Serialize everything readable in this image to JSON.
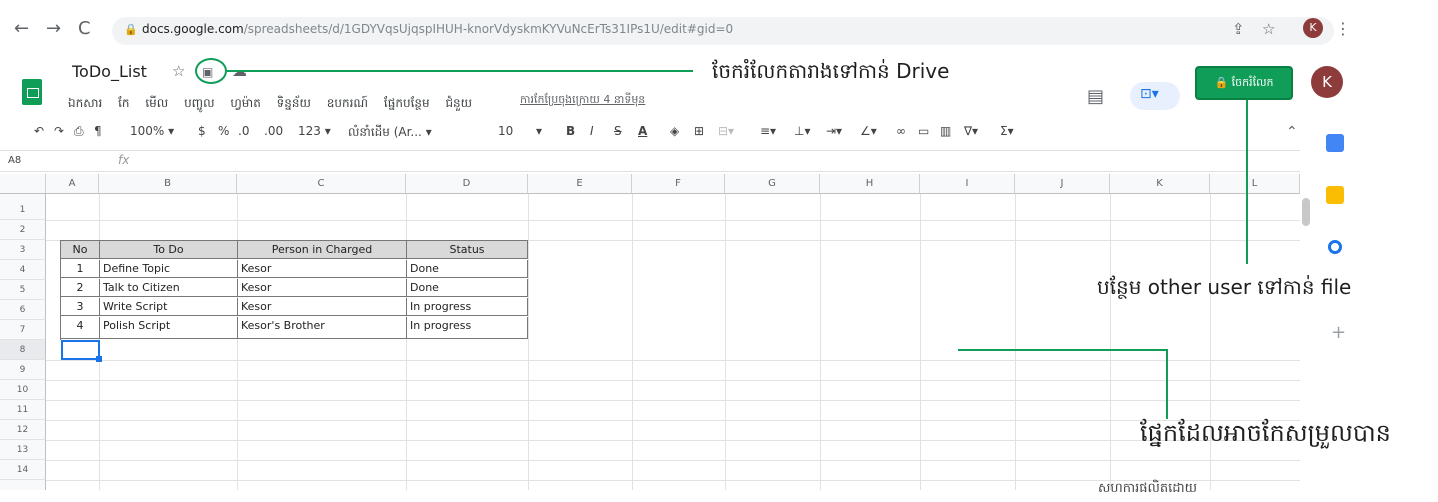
{
  "browser": {
    "url_host": "docs.google.com",
    "url_path": "/spreadsheets/d/1GDYVqsUjqspIHUH-knorVdyskmKYVuNcErTs31IPs1U/edit#gid=0",
    "avatar_letter": "K"
  },
  "sheet": {
    "title": "ToDo_List",
    "menu": [
      "ឯកសារ",
      "កែ",
      "មើល",
      "បញ្ចូល",
      "ហ្វម៉ាត",
      "ទិន្នន័យ",
      "ឧបករណ៍",
      "ផ្នែកបន្ថែម",
      "ជំនួយ"
    ],
    "last_edit": "ការកែប្រែចុងក្រោយ 4 នាទីមុន",
    "share_label": "ចែករំលែក",
    "avatar_letter": "K"
  },
  "toolbar": {
    "zoom": "100%",
    "currency": "$",
    "percent": "%",
    "dec_less": ".0",
    "dec_more": ".00",
    "format": "123",
    "font": "លំនាំដើម (Ar...",
    "font_size": "10",
    "bold": "B",
    "italic": "I",
    "strike": "S",
    "underline": "A"
  },
  "formula_bar": {
    "cell_ref": "A8",
    "fx": "fx"
  },
  "columns": [
    "A",
    "B",
    "C",
    "D",
    "E",
    "F",
    "G",
    "H",
    "I",
    "J",
    "K",
    "L"
  ],
  "rows": [
    "1",
    "2",
    "3",
    "4",
    "5",
    "6",
    "7",
    "8",
    "9",
    "10",
    "11",
    "12",
    "13",
    "14"
  ],
  "table": {
    "headers": [
      "No",
      "To Do",
      "Person in Charged",
      "Status"
    ],
    "rows": [
      [
        "1",
        "Define Topic",
        "Kesor",
        "Done"
      ],
      [
        "2",
        "Talk to Citizen",
        "Kesor",
        "Done"
      ],
      [
        "3",
        "Write Script",
        "Kesor",
        "In progress"
      ],
      [
        "4",
        "Polish Script",
        "Kesor's Brother",
        "In progress"
      ]
    ]
  },
  "annotations": {
    "move_to_drive": "ចែករំលែកតារាងទៅកាន់ Drive",
    "add_user": "បន្ថែម other user ទៅកាន់ file",
    "editable_area": "ផ្នែកដែលអាចកែសម្រួលបាន",
    "credit": "សហការផលិតដោយ"
  },
  "colors": {
    "accent": "#0f9d58",
    "selection": "#1a73e8"
  }
}
